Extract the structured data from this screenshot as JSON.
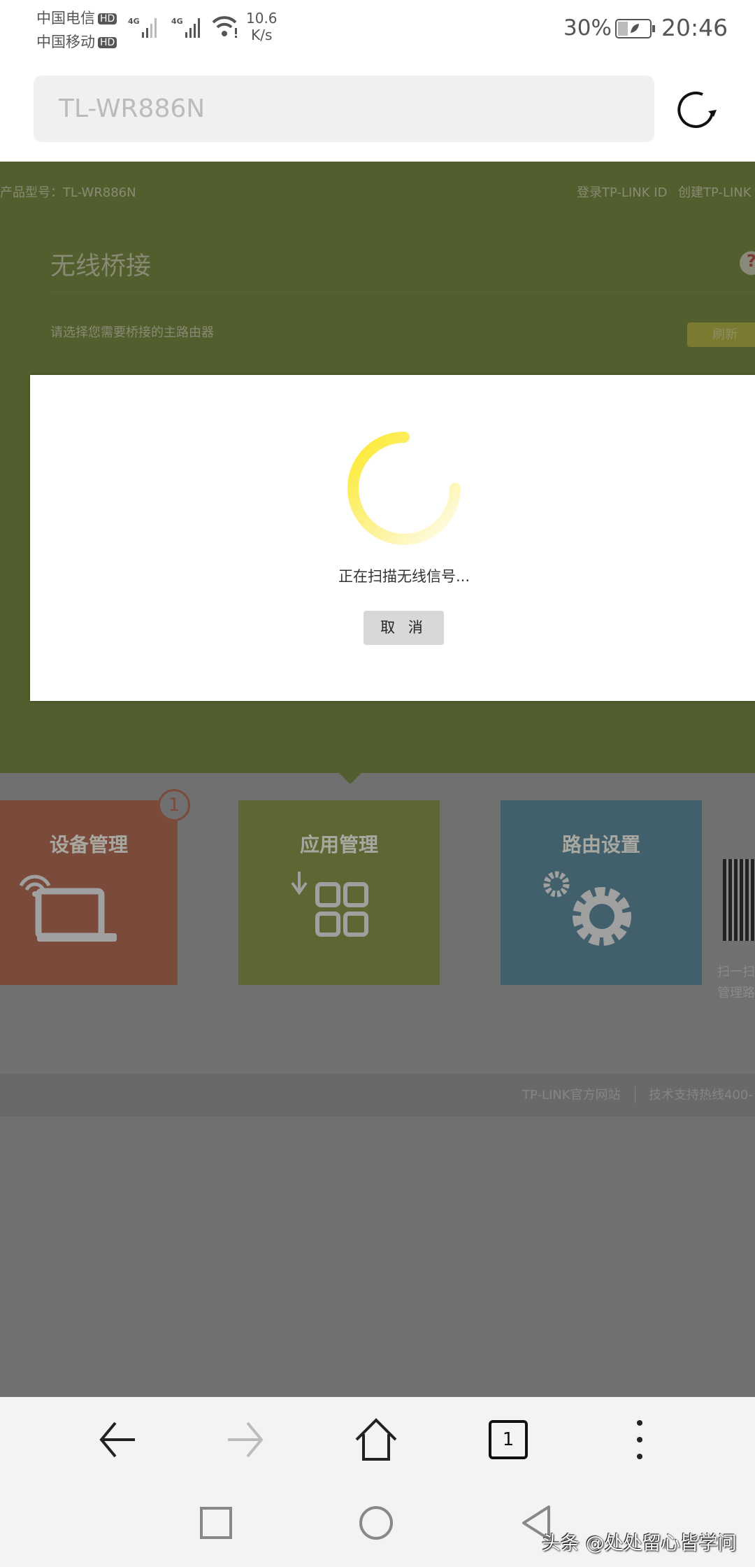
{
  "status_bar": {
    "carrier1": "中国电信",
    "carrier2": "中国移动",
    "hd": "HD",
    "net": "4G",
    "speed_value": "10.6",
    "speed_unit": "K/s",
    "battery": "30%",
    "time": "20:46"
  },
  "browser": {
    "url": "TL-WR886N",
    "tab_count": "1"
  },
  "page": {
    "product_model": "产品型号：TL-WR886N",
    "login_link": "登录TP-LINK ID",
    "create_link": "创建TP-LINK",
    "title": "无线桥接",
    "help": "?",
    "subtitle": "请选择您需要桥接的主路由器",
    "refresh": "刷新",
    "tiles": [
      {
        "label": "设备管理",
        "badge": "1",
        "color": "#7a4a3a"
      },
      {
        "label": "应用管理",
        "color": "#5e6634"
      },
      {
        "label": "路由设置",
        "color": "#42606b"
      }
    ],
    "qr_text1": "扫一扫",
    "qr_text2": "管理路",
    "footer_link": "TP-LINK官方网站",
    "footer_hotline": "技术支持热线400-"
  },
  "dialog": {
    "message": "正在扫描无线信号...",
    "cancel": "取 消"
  },
  "watermark": "头条 @处处留心皆学问"
}
